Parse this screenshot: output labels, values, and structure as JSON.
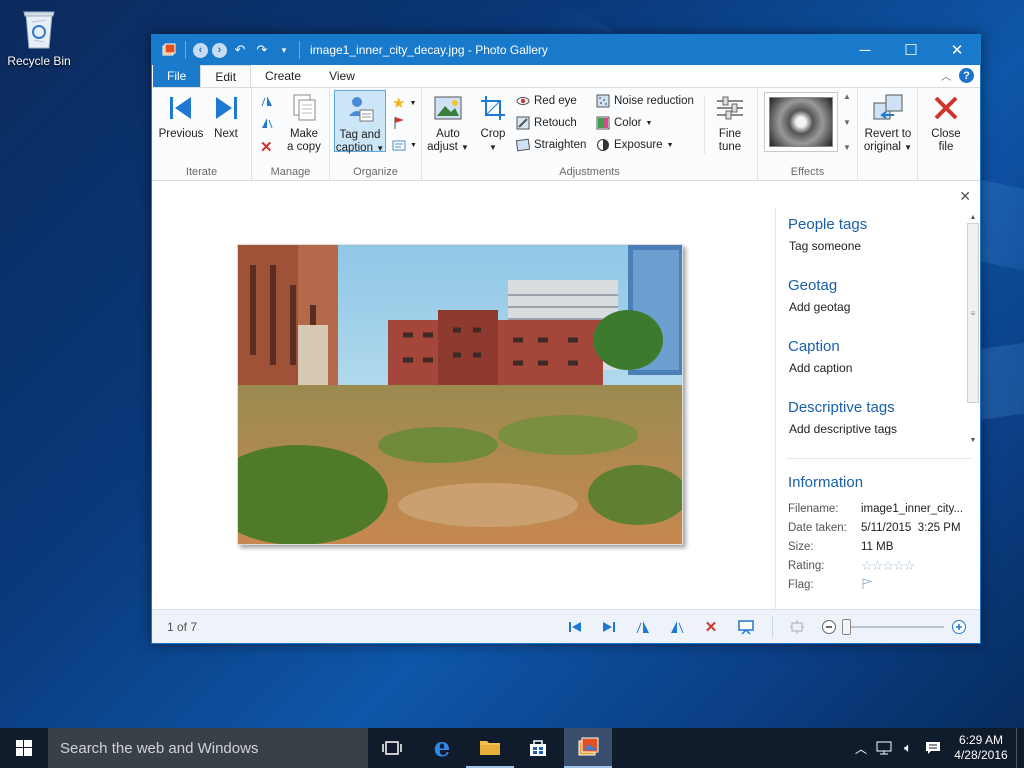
{
  "desktop": {
    "recycle_bin_label": "Recycle Bin"
  },
  "window": {
    "title": "image1_inner_city_decay.jpg - Photo Gallery",
    "tabs": [
      {
        "label": "File"
      },
      {
        "label": "Edit"
      },
      {
        "label": "Create"
      },
      {
        "label": "View"
      }
    ],
    "ribbon": {
      "iterate": {
        "label": "Iterate",
        "previous": "Previous",
        "next": "Next"
      },
      "manage": {
        "label": "Manage",
        "make_copy_1": "Make",
        "make_copy_2": "a copy"
      },
      "organize": {
        "label": "Organize",
        "tag_caption_1": "Tag and",
        "tag_caption_2": "caption"
      },
      "adjustments": {
        "label": "Adjustments",
        "auto_adjust_1": "Auto",
        "auto_adjust_2": "adjust",
        "crop": "Crop",
        "red_eye": "Red eye",
        "retouch": "Retouch",
        "straighten": "Straighten",
        "noise_reduction": "Noise reduction",
        "color": "Color",
        "exposure": "Exposure",
        "fine_tune_1": "Fine",
        "fine_tune_2": "tune"
      },
      "effects": {
        "label": "Effects"
      },
      "revert_1": "Revert to",
      "revert_2": "original",
      "close_1": "Close",
      "close_2": "file"
    },
    "pane": {
      "people_tags": "People tags",
      "tag_someone": "Tag someone",
      "geotag": "Geotag",
      "add_geotag": "Add geotag",
      "caption": "Caption",
      "add_caption": "Add caption",
      "descriptive_tags": "Descriptive tags",
      "add_descriptive_tags": "Add descriptive tags",
      "information": "Information",
      "info": [
        {
          "key": "Filename:",
          "value": "image1_inner_city..."
        },
        {
          "key": "Date taken:",
          "value": "5/11/2015  3:25 PM"
        },
        {
          "key": "Size:",
          "value": "11 MB"
        },
        {
          "key": "Rating:",
          "value": ""
        },
        {
          "key": "Flag:",
          "value": ""
        }
      ]
    },
    "status": {
      "counter": "1 of 7",
      "zoom_level": 0
    }
  },
  "taskbar": {
    "search_placeholder": "Search the web and Windows",
    "time": "6:29 AM",
    "date": "4/28/2016"
  },
  "colors": {
    "accent": "#1979ca",
    "taskbar": "#101b2b"
  }
}
